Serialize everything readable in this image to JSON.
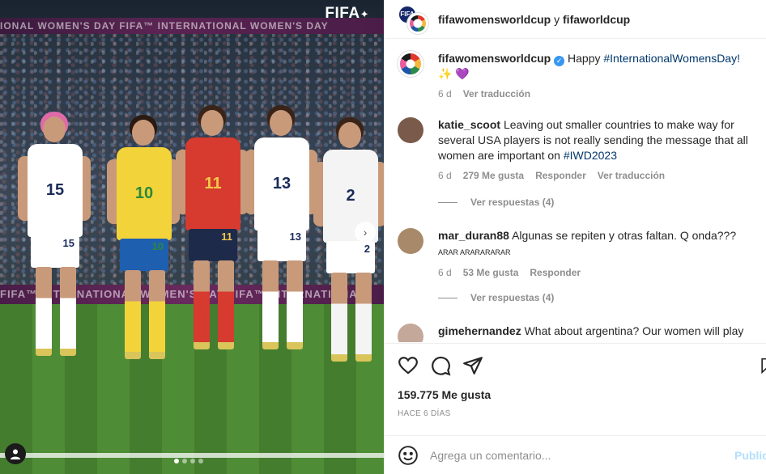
{
  "media": {
    "banner_top_text": "IONAL WOMEN'S DAY    FIFA™ INTERNATIONAL WOMEN'S DAY",
    "banner_bottom_text": "FIFA™ INTERNATIONAL WOMEN'S DAY    FIFA™ INTERNATIONAL",
    "logo_text": "FIFA",
    "players": [
      {
        "number": "15",
        "shirt": "#ffffff",
        "shorts": "#ffffff",
        "hair": "#e06aa8",
        "text": "#1b2b5a"
      },
      {
        "number": "10",
        "shirt": "#f3d33a",
        "shorts": "#1e5fb0",
        "hair": "#2a1a12",
        "text": "#2b8a3a"
      },
      {
        "number": "11",
        "shirt": "#d73a2e",
        "shorts": "#1e2a4a",
        "hair": "#3a2418",
        "text": "#f1c84a"
      },
      {
        "number": "13",
        "shirt": "#ffffff",
        "shorts": "#ffffff",
        "hair": "#3a2418",
        "text": "#1b2b5a"
      },
      {
        "number": "2",
        "shirt": "#f4f4f4",
        "shorts": "#ffffff",
        "hair": "#3a2418",
        "text": "#1b2b5a"
      }
    ],
    "carousel_active_index": 0,
    "carousel_count": 4
  },
  "header": {
    "account_1": "fifawomensworldcup",
    "joiner": "y",
    "account_2": "fifaworldcup",
    "avatar_1_text": "FIFA"
  },
  "caption": {
    "username": "fifawomensworldcup",
    "text_prefix": "Happy",
    "hashtag": "#InternationalWomensDay!",
    "emojis": "✨ 💜",
    "time": "6 d",
    "translate": "Ver traducción"
  },
  "comments": [
    {
      "username": "katie_scoot",
      "text": "Leaving out smaller countries to make way for several USA players is not really sending the message that all women are important on",
      "hashtag": "#IWD2023",
      "time": "6 d",
      "likes": "279 Me gusta",
      "reply": "Responder",
      "translate": "Ver traducción",
      "view_replies": "Ver respuestas (4)",
      "avatar_color": "#7a5a4a"
    },
    {
      "username": "mar_duran88",
      "text": "Algunas se repiten y otras faltan. Q onda???",
      "small_text": "ARAR ARARARARAR",
      "time": "6 d",
      "likes": "53 Me gusta",
      "reply": "Responder",
      "view_replies": "Ver respuestas (4)",
      "avatar_color": "#a88a6a"
    },
    {
      "username": "gimehernandez",
      "text": "What about argentina? Our women will play",
      "avatar_color": "#c4a89a"
    }
  ],
  "actions": {
    "like_icon": "heart-icon",
    "comment_icon": "comment-icon",
    "share_icon": "send-icon",
    "save_icon": "bookmark-icon",
    "likes_count": "159.775 Me gusta",
    "posted_ago": "HACE 6 DÍAS"
  },
  "composer": {
    "placeholder": "Agrega un comentario...",
    "publish_label": "Publicar",
    "emoji_icon": "emoji-icon"
  }
}
